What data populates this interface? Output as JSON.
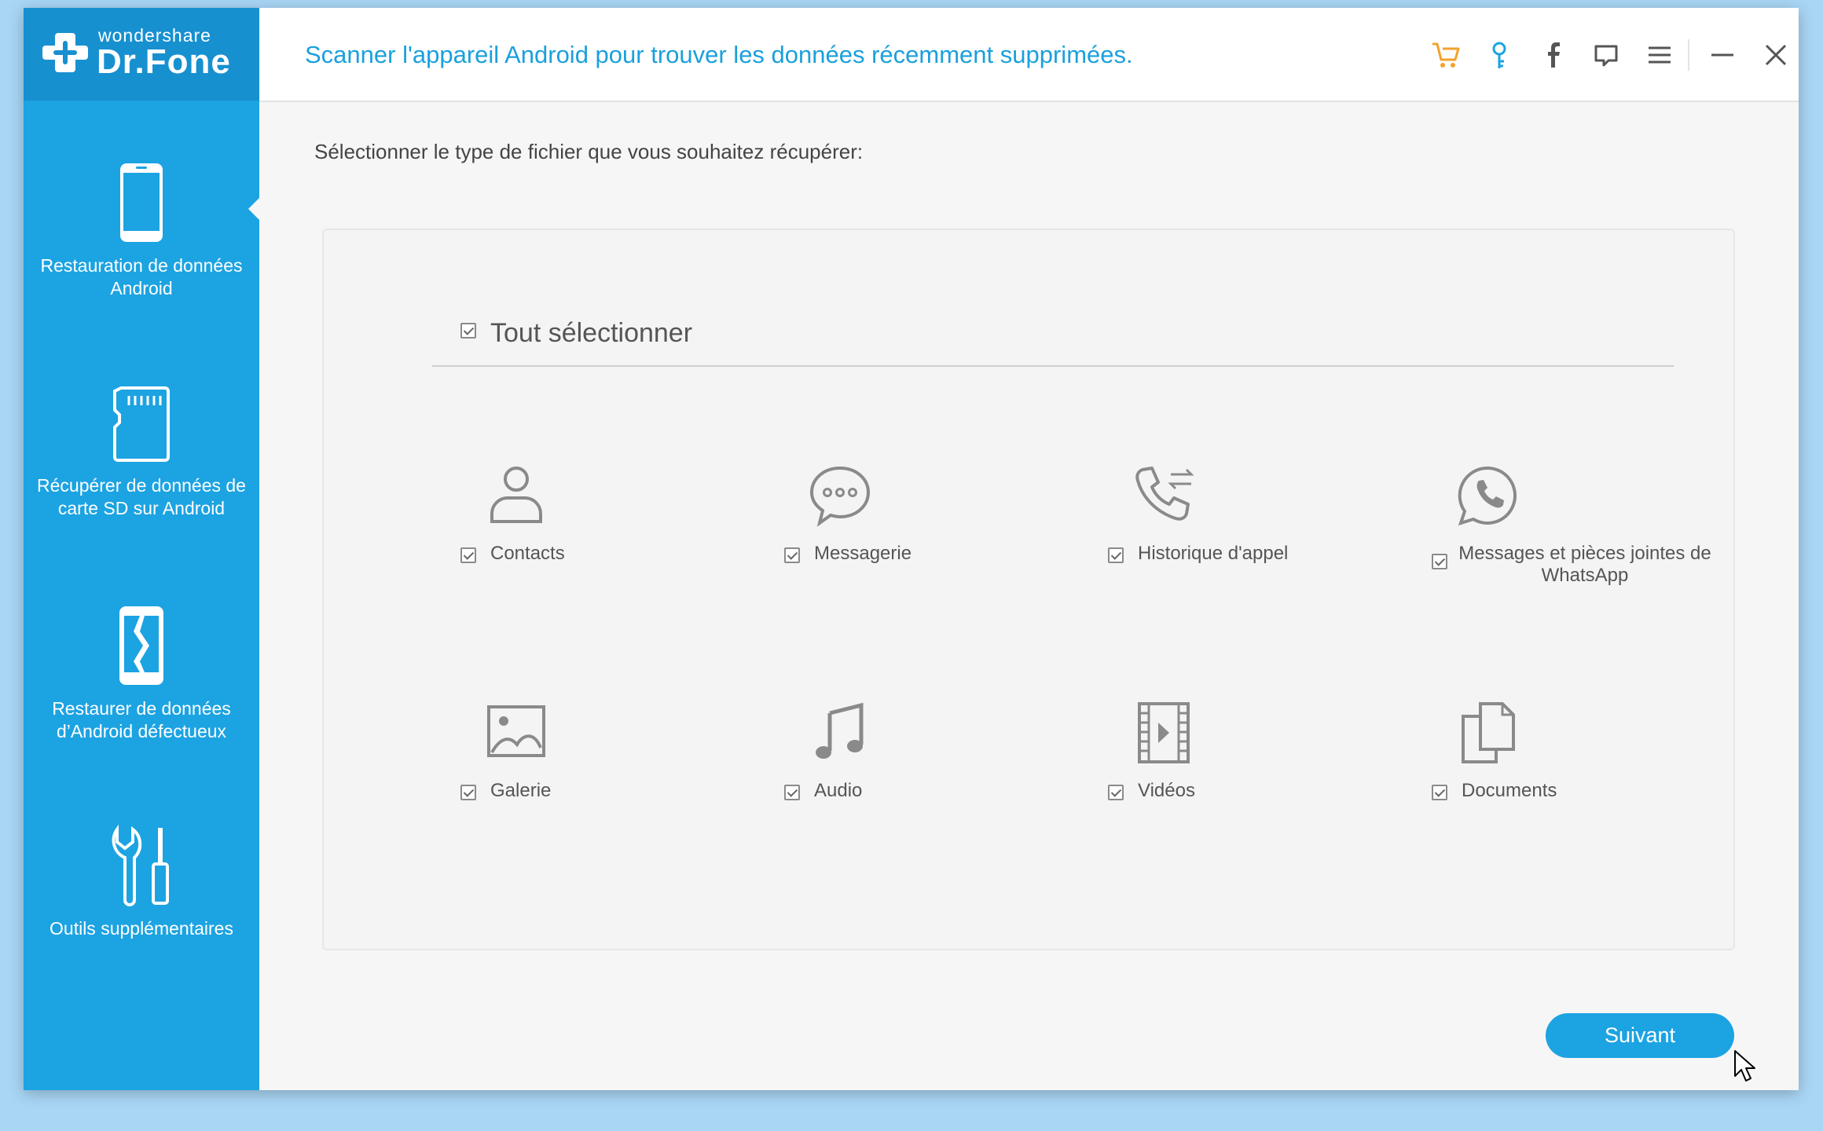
{
  "app": {
    "brand": "wondershare",
    "product": "Dr.Fone",
    "accent_color": "#1ca3e2",
    "logo_icon": "plus-cross-icon"
  },
  "header": {
    "title": "Scanner l'appareil Android pour trouver les données récemment supprimées.",
    "icons": [
      "cart-icon",
      "key-icon",
      "facebook-icon",
      "feedback-icon",
      "menu-icon",
      "minimize-icon",
      "close-icon"
    ]
  },
  "sidebar": {
    "items": [
      {
        "label": "Restauration de données Android",
        "icon": "phone-icon",
        "active": true
      },
      {
        "label": "Récupérer de données de carte SD sur Android",
        "icon": "sd-card-icon"
      },
      {
        "label": "Restaurer de données d’Android défectueux",
        "icon": "broken-phone-icon"
      },
      {
        "label": "Outils supplémentaires",
        "icon": "tools-icon"
      }
    ]
  },
  "main": {
    "prompt": "Sélectionner le type de fichier que vous souhaitez récupérer:",
    "select_all_label": "Tout sélectionner",
    "select_all_checked": true,
    "file_types": [
      {
        "label": "Contacts",
        "icon": "person-icon",
        "checked": true
      },
      {
        "label": "Messagerie",
        "icon": "chat-bubble-icon",
        "checked": true
      },
      {
        "label": "Historique d'appel",
        "icon": "call-history-icon",
        "checked": true
      },
      {
        "label": "Messages et pièces jointes de WhatsApp",
        "icon": "whatsapp-icon",
        "checked": true
      },
      {
        "label": "Galerie",
        "icon": "image-icon",
        "checked": true
      },
      {
        "label": "Audio",
        "icon": "music-note-icon",
        "checked": true
      },
      {
        "label": "Vidéos",
        "icon": "film-icon",
        "checked": true
      },
      {
        "label": "Documents",
        "icon": "documents-icon",
        "checked": true
      }
    ],
    "next_button": "Suivant"
  }
}
